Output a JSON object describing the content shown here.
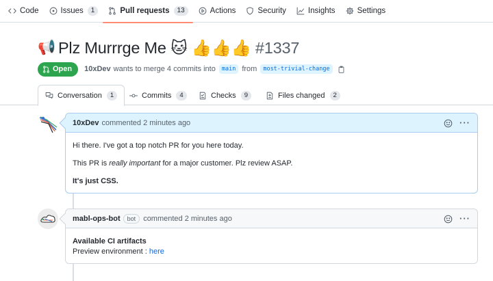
{
  "repo_nav": {
    "items": [
      {
        "icon": "code-icon",
        "label": "Code"
      },
      {
        "icon": "issue-icon",
        "label": "Issues",
        "count": "1"
      },
      {
        "icon": "pull-request-icon",
        "label": "Pull requests",
        "count": "13",
        "selected": true
      },
      {
        "icon": "play-icon",
        "label": "Actions"
      },
      {
        "icon": "shield-icon",
        "label": "Security"
      },
      {
        "icon": "graph-icon",
        "label": "Insights"
      },
      {
        "icon": "gear-icon",
        "label": "Settings"
      }
    ]
  },
  "pr": {
    "title_emoji": "📢",
    "title": "Plz Murrrge Me 🐱 👍👍👍",
    "number": "#1337",
    "state": "Open",
    "author": "10xDev",
    "merge_text": "wants to merge 4 commits into",
    "base_branch": "main",
    "from_text": "from",
    "head_branch": "most-trivial-change"
  },
  "tabs": [
    {
      "icon": "comment-discussion-icon",
      "label": "Conversation",
      "count": "1",
      "active": true
    },
    {
      "icon": "commit-icon",
      "label": "Commits",
      "count": "4"
    },
    {
      "icon": "checklist-icon",
      "label": "Checks",
      "count": "9"
    },
    {
      "icon": "file-diff-icon",
      "label": "Files changed",
      "count": "2"
    }
  ],
  "comments": [
    {
      "author": "10xDev",
      "action": "commented 2 minutes ago",
      "body": {
        "p1": "Hi there. I've got a top notch PR for you here today.",
        "p2_before": "This PR is ",
        "p2_emphasis": "really important",
        "p2_after": " for a major customer. Plz review ASAP.",
        "p3": "It's just CSS."
      }
    },
    {
      "author": "mabl-ops-bot",
      "badge": "bot",
      "action": "commented 2 minutes ago",
      "body": {
        "heading": "Available CI artifacts",
        "line_prefix": "Preview environment : ",
        "link": "here"
      }
    }
  ],
  "colors": {
    "accent_underline": "#fd8c73",
    "open_badge": "#2da44e",
    "link": "#0969da",
    "highlight_header": "#ddf4ff"
  }
}
